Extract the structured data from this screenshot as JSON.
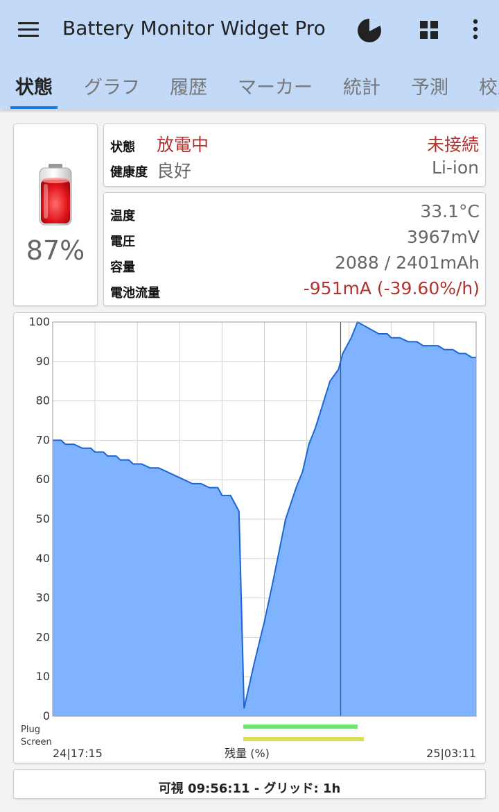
{
  "app": {
    "title": "Battery Monitor Widget Pro",
    "actions": [
      "pie-chart-icon",
      "grid-icon",
      "more-vert-icon"
    ]
  },
  "tabs": [
    {
      "label": "状態",
      "active": true
    },
    {
      "label": "グラフ",
      "active": false
    },
    {
      "label": "履歴",
      "active": false
    },
    {
      "label": "マーカー",
      "active": false
    },
    {
      "label": "統計",
      "active": false
    },
    {
      "label": "予測",
      "active": false
    },
    {
      "label": "校正",
      "active": false
    }
  ],
  "battery": {
    "percent": "87%",
    "level": 0.87
  },
  "status": {
    "state_label": "状態",
    "state_value": "放電中",
    "plug_value": "未接続",
    "health_label": "健康度",
    "health_value": "良好",
    "tech_value": "Li-ion"
  },
  "details": {
    "temp_label": "温度",
    "temp_value": "33.1°C",
    "voltage_label": "電圧",
    "voltage_value": "3967mV",
    "capacity_label": "容量",
    "capacity_value": "2088 / 2401mAh",
    "current_label": "電池流量",
    "current_value": "-951mA (-39.60%/h)"
  },
  "chart_data": {
    "type": "area",
    "ylim": [
      0,
      100
    ],
    "y_ticks": [
      "100",
      "90",
      "80",
      "70",
      "60",
      "50",
      "40",
      "30",
      "20",
      "10",
      "0"
    ],
    "x_start_label": "24|17:15",
    "x_end_label": "25|03:11",
    "xlabel": "残量 (%)",
    "plug_label": "Plug",
    "screen_label": "Screen",
    "grid": true,
    "fill_color": "#7fb2ff",
    "line_color": "#1a66d6",
    "plug_color": "#6ee86a",
    "screen_color": "#d8dc5a",
    "points": [
      [
        0.0,
        70
      ],
      [
        0.02,
        70
      ],
      [
        0.03,
        69
      ],
      [
        0.05,
        69
      ],
      [
        0.07,
        68
      ],
      [
        0.09,
        68
      ],
      [
        0.1,
        67
      ],
      [
        0.12,
        67
      ],
      [
        0.13,
        66
      ],
      [
        0.15,
        66
      ],
      [
        0.16,
        65
      ],
      [
        0.18,
        65
      ],
      [
        0.19,
        64
      ],
      [
        0.21,
        64
      ],
      [
        0.23,
        63
      ],
      [
        0.25,
        63
      ],
      [
        0.27,
        62
      ],
      [
        0.29,
        61
      ],
      [
        0.31,
        60
      ],
      [
        0.33,
        59
      ],
      [
        0.35,
        59
      ],
      [
        0.37,
        58
      ],
      [
        0.39,
        58
      ],
      [
        0.4,
        56
      ],
      [
        0.42,
        56
      ],
      [
        0.44,
        52
      ],
      [
        0.452,
        2
      ],
      [
        0.475,
        13
      ],
      [
        0.5,
        24
      ],
      [
        0.52,
        34
      ],
      [
        0.55,
        50
      ],
      [
        0.575,
        58
      ],
      [
        0.59,
        62
      ],
      [
        0.605,
        69
      ],
      [
        0.62,
        73
      ],
      [
        0.655,
        85
      ],
      [
        0.675,
        88
      ],
      [
        0.685,
        92
      ],
      [
        0.705,
        96
      ],
      [
        0.72,
        100
      ],
      [
        0.77,
        97
      ],
      [
        0.79,
        97
      ],
      [
        0.8,
        96
      ],
      [
        0.82,
        96
      ],
      [
        0.84,
        95
      ],
      [
        0.86,
        95
      ],
      [
        0.875,
        94
      ],
      [
        0.91,
        94
      ],
      [
        0.925,
        93
      ],
      [
        0.945,
        93
      ],
      [
        0.96,
        92
      ],
      [
        0.975,
        92
      ],
      [
        0.99,
        91
      ],
      [
        1.0,
        91
      ]
    ],
    "cursor_x": 0.68,
    "plug_range": [
      0.45,
      0.72
    ],
    "screen_range": [
      0.45,
      0.735
    ]
  },
  "footer": {
    "text": "可視 09:56:11 - グリッド: 1h"
  }
}
